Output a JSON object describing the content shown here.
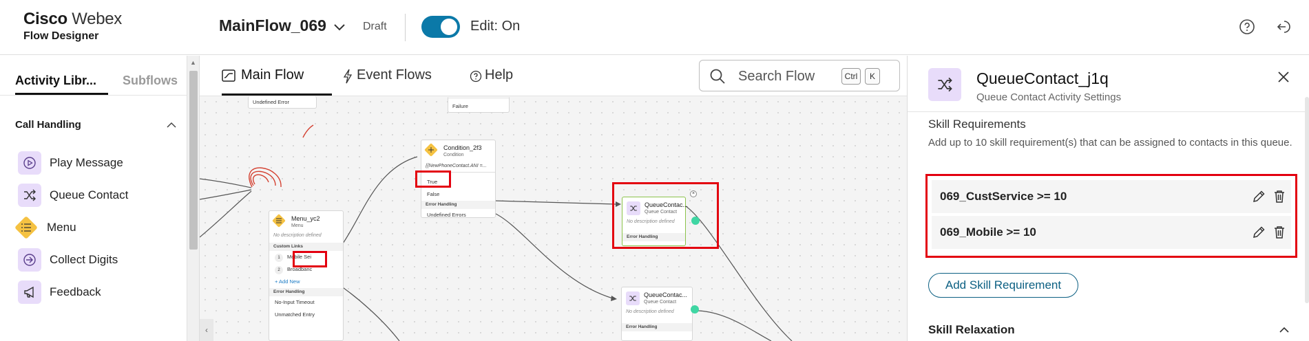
{
  "header": {
    "brand_bold": "Cisco",
    "brand_light": "Webex",
    "product": "Flow Designer",
    "flow_name": "MainFlow_069",
    "status": "Draft",
    "edit_label": "Edit: On"
  },
  "sidebar": {
    "tabs": [
      "Activity Libr...",
      "Subflows"
    ],
    "section": "Call Handling",
    "items": [
      {
        "label": "Play Message",
        "icon": "play-icon"
      },
      {
        "label": "Queue Contact",
        "icon": "shuffle-icon"
      },
      {
        "label": "Menu",
        "icon": "menu-list-icon"
      },
      {
        "label": "Collect Digits",
        "icon": "arrow-in-icon"
      },
      {
        "label": "Feedback",
        "icon": "megaphone-icon"
      }
    ]
  },
  "canvas": {
    "tabs": [
      "Main Flow",
      "Event Flows",
      "Help"
    ],
    "search_placeholder": "Search Flow",
    "kbd": [
      "Ctrl",
      "K"
    ],
    "nodes": {
      "undef_top": "Undefined Error",
      "failure_top": "Failure",
      "condition": {
        "title": "Condition_2f3",
        "sub": "Condition",
        "expr": "{{NewPhoneContact.ANI =...",
        "true": "True",
        "false": "False",
        "err_section": "Error Handling",
        "err_row": "Undefined Errors"
      },
      "menu": {
        "title": "Menu_yc2",
        "sub": "Menu",
        "desc": "No description defined",
        "links_section": "Custom Links",
        "link1_num": "1",
        "link1": "Mobile Sei",
        "link2_num": "2",
        "link2": "Broadbanc",
        "add_new": "+ Add New",
        "err_section": "Error Handling",
        "err1": "No-Input Timeout",
        "err2": "Unmatched Entry"
      },
      "queue1": {
        "title": "QueueContac...",
        "sub": "Queue Contact",
        "desc": "No description defined",
        "err_section": "Error Handling"
      },
      "queue2": {
        "title": "QueueContac...",
        "sub": "Queue Contact",
        "desc": "No description defined",
        "err_section": "Error Handling"
      }
    }
  },
  "panel": {
    "title": "QueueContact_j1q",
    "subtitle": "Queue Contact Activity Settings",
    "section_title": "Skill Requirements",
    "description": "Add up to 10 skill requirement(s) that can be assigned to contacts in this queue.",
    "skills": [
      "069_CustService >= 10",
      "069_Mobile >= 10"
    ],
    "add_button": "Add Skill Requirement",
    "section2": "Skill Relaxation"
  },
  "colors": {
    "accent": "#0b79a8",
    "activity_icon_bg": "#e8dcfa",
    "highlight_red": "#e3000f",
    "menu_diamond": "#f5c242"
  }
}
